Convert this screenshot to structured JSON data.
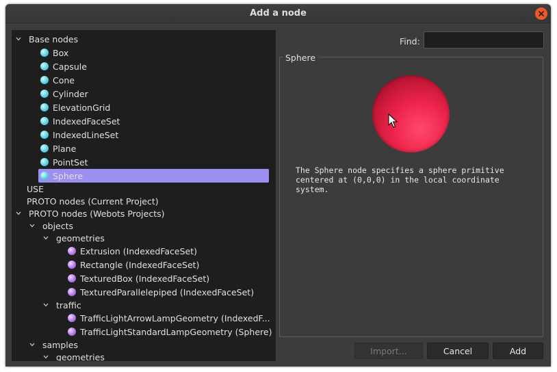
{
  "window": {
    "title": "Add a node"
  },
  "find": {
    "label": "Find:",
    "value": "",
    "placeholder": ""
  },
  "preview": {
    "group_title": "Sphere",
    "description": "The Sphere node specifies a sphere primitive\ncentered at (0,0,0) in the local coordinate\nsystem.",
    "sphere_color": "#f0264e"
  },
  "buttons": {
    "import": "Import...",
    "cancel": "Cancel",
    "add": "Add"
  },
  "tree": {
    "base_nodes": "Base nodes",
    "items": [
      "Box",
      "Capsule",
      "Cone",
      "Cylinder",
      "ElevationGrid",
      "IndexedFaceSet",
      "IndexedLineSet",
      "Plane",
      "PointSet",
      "Sphere"
    ],
    "use": "USE",
    "proto_current": "PROTO nodes (Current Project)",
    "proto_webots": "PROTO nodes (Webots Projects)",
    "objects": "objects",
    "geometries": "geometries",
    "geometries_items": [
      "Extrusion (IndexedFaceSet)",
      "Rectangle (IndexedFaceSet)",
      "TexturedBox (IndexedFaceSet)",
      "TexturedParallelepiped (IndexedFaceSet)"
    ],
    "traffic": "traffic",
    "traffic_items": [
      "TrafficLightArrowLampGeometry (IndexedF...",
      "TrafficLightStandardLampGeometry (Sphere)"
    ],
    "samples": "samples",
    "samples_geometries": "geometries"
  },
  "colors": {
    "selection": "#9b8ff0",
    "base_node_dot": "#58d3e2",
    "proto_dot": "#b678f0",
    "close": "#e9592c"
  }
}
